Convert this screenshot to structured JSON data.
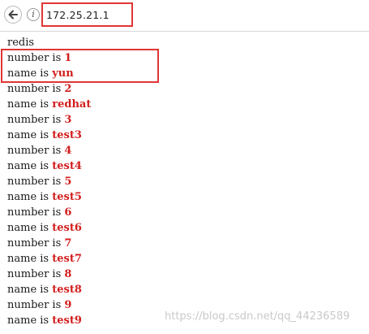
{
  "browser": {
    "url": "172.25.21.1"
  },
  "page": {
    "heading": "redis",
    "rows": [
      {
        "label": "number is ",
        "value": "1"
      },
      {
        "label": "name is ",
        "value": "yun"
      },
      {
        "label": "number is ",
        "value": "2"
      },
      {
        "label": "name is ",
        "value": "redhat"
      },
      {
        "label": "number is ",
        "value": "3"
      },
      {
        "label": "name is ",
        "value": "test3"
      },
      {
        "label": "number is ",
        "value": "4"
      },
      {
        "label": "name is ",
        "value": "test4"
      },
      {
        "label": "number is ",
        "value": "5"
      },
      {
        "label": "name is ",
        "value": "test5"
      },
      {
        "label": "number is ",
        "value": "6"
      },
      {
        "label": "name is ",
        "value": "test6"
      },
      {
        "label": "number is ",
        "value": "7"
      },
      {
        "label": "name is ",
        "value": "test7"
      },
      {
        "label": "number is ",
        "value": "8"
      },
      {
        "label": "name is ",
        "value": "test8"
      },
      {
        "label": "number is ",
        "value": "9"
      },
      {
        "label": "name is ",
        "value": "test9"
      }
    ]
  },
  "watermark": "https://blog.csdn.net/qq_44236589",
  "colors": {
    "value_text": "#d21d1d",
    "highlight_box": "#e03535"
  },
  "icons": {
    "back": "arrow-left-icon",
    "info": "info-icon"
  }
}
